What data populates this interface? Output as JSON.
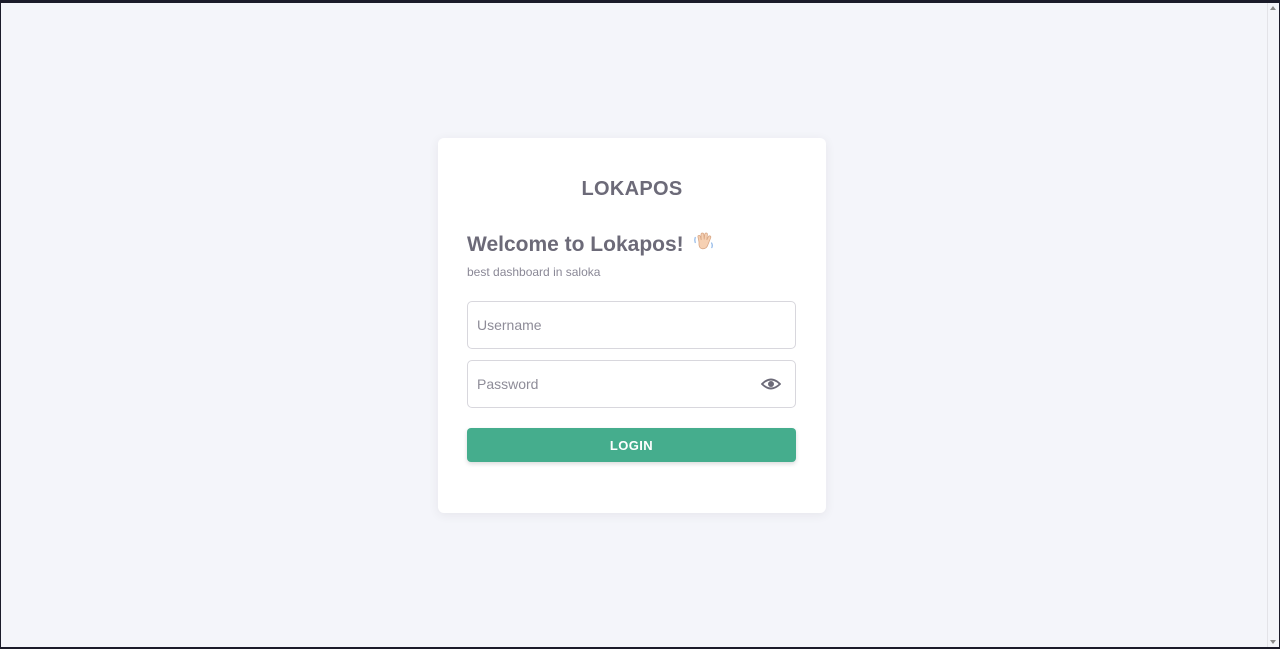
{
  "brand": {
    "name": "LOKAPOS"
  },
  "login": {
    "welcome": "Welcome to Lokapos!",
    "wave_icon": "waving-hand-icon",
    "subtitle": "best dashboard in saloka",
    "username": {
      "value": "",
      "placeholder": "Username"
    },
    "password": {
      "value": "",
      "placeholder": "Password",
      "toggle_icon": "eye-icon"
    },
    "submit_label": "LOGIN"
  },
  "colors": {
    "background": "#f4f5fa",
    "card": "#ffffff",
    "text": "#6c6a78",
    "accent": "#45ad8d"
  }
}
